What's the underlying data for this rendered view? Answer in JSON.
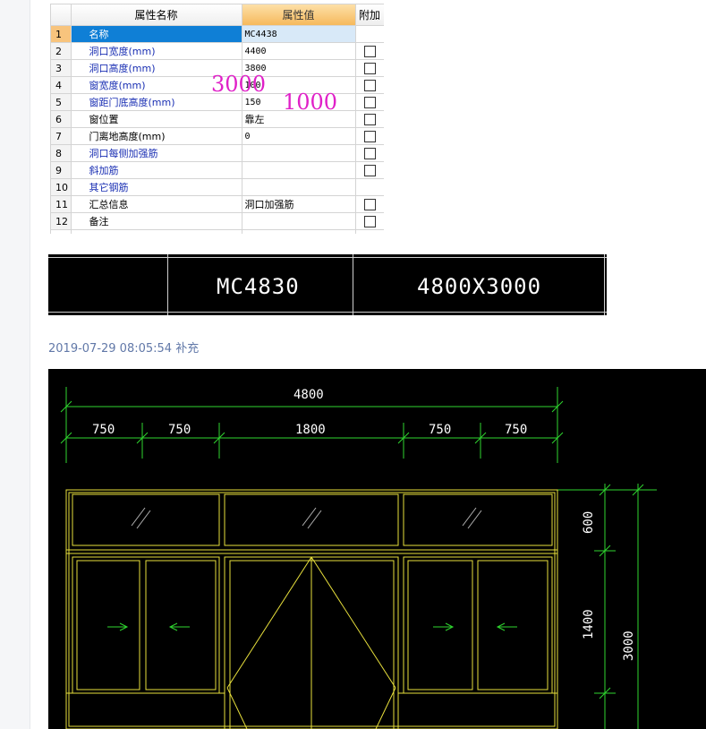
{
  "property_table": {
    "headers": {
      "index": "",
      "name": "属性名称",
      "value": "属性值",
      "extra": "附加"
    },
    "rows": [
      {
        "num": "1",
        "name": "名称",
        "value": "MC4438",
        "checkbox": false,
        "selected": true
      },
      {
        "num": "2",
        "name": "洞口宽度(mm)",
        "value": "4400",
        "checkbox": true
      },
      {
        "num": "3",
        "name": "洞口高度(mm)",
        "value": "3800",
        "checkbox": true
      },
      {
        "num": "4",
        "name": "窗宽度(mm)",
        "value": "100",
        "checkbox": true
      },
      {
        "num": "5",
        "name": "窗距门底高度(mm)",
        "value": "150",
        "checkbox": true
      },
      {
        "num": "6",
        "name": "窗位置",
        "value": "靠左",
        "checkbox": true
      },
      {
        "num": "7",
        "name": "门离地高度(mm)",
        "value": "0",
        "checkbox": true
      },
      {
        "num": "8",
        "name": "洞口每侧加强筋",
        "value": "",
        "checkbox": true
      },
      {
        "num": "9",
        "name": "斜加筋",
        "value": "",
        "checkbox": true
      },
      {
        "num": "10",
        "name": "其它钢筋",
        "value": "",
        "checkbox": false
      },
      {
        "num": "11",
        "name": "汇总信息",
        "value": "洞口加强筋",
        "checkbox": true
      },
      {
        "num": "12",
        "name": "备注",
        "value": "",
        "checkbox": true
      }
    ]
  },
  "annotations": {
    "left": "3000",
    "right": "1000",
    "color": "#e020c8"
  },
  "cad_strip": {
    "code": "MC4830",
    "size": "4800X3000"
  },
  "timestamp_note": "2019-07-29 08:05:54 补充",
  "drawing": {
    "total_width": "4800",
    "segments": [
      "750",
      "750",
      "1800",
      "750",
      "750"
    ],
    "vertical_dims": [
      "600",
      "1400",
      "3000"
    ],
    "colors": {
      "frame": "#e8e03c",
      "dimension": "#2fd62f",
      "text": "#ffffff",
      "background": "#000000"
    }
  }
}
